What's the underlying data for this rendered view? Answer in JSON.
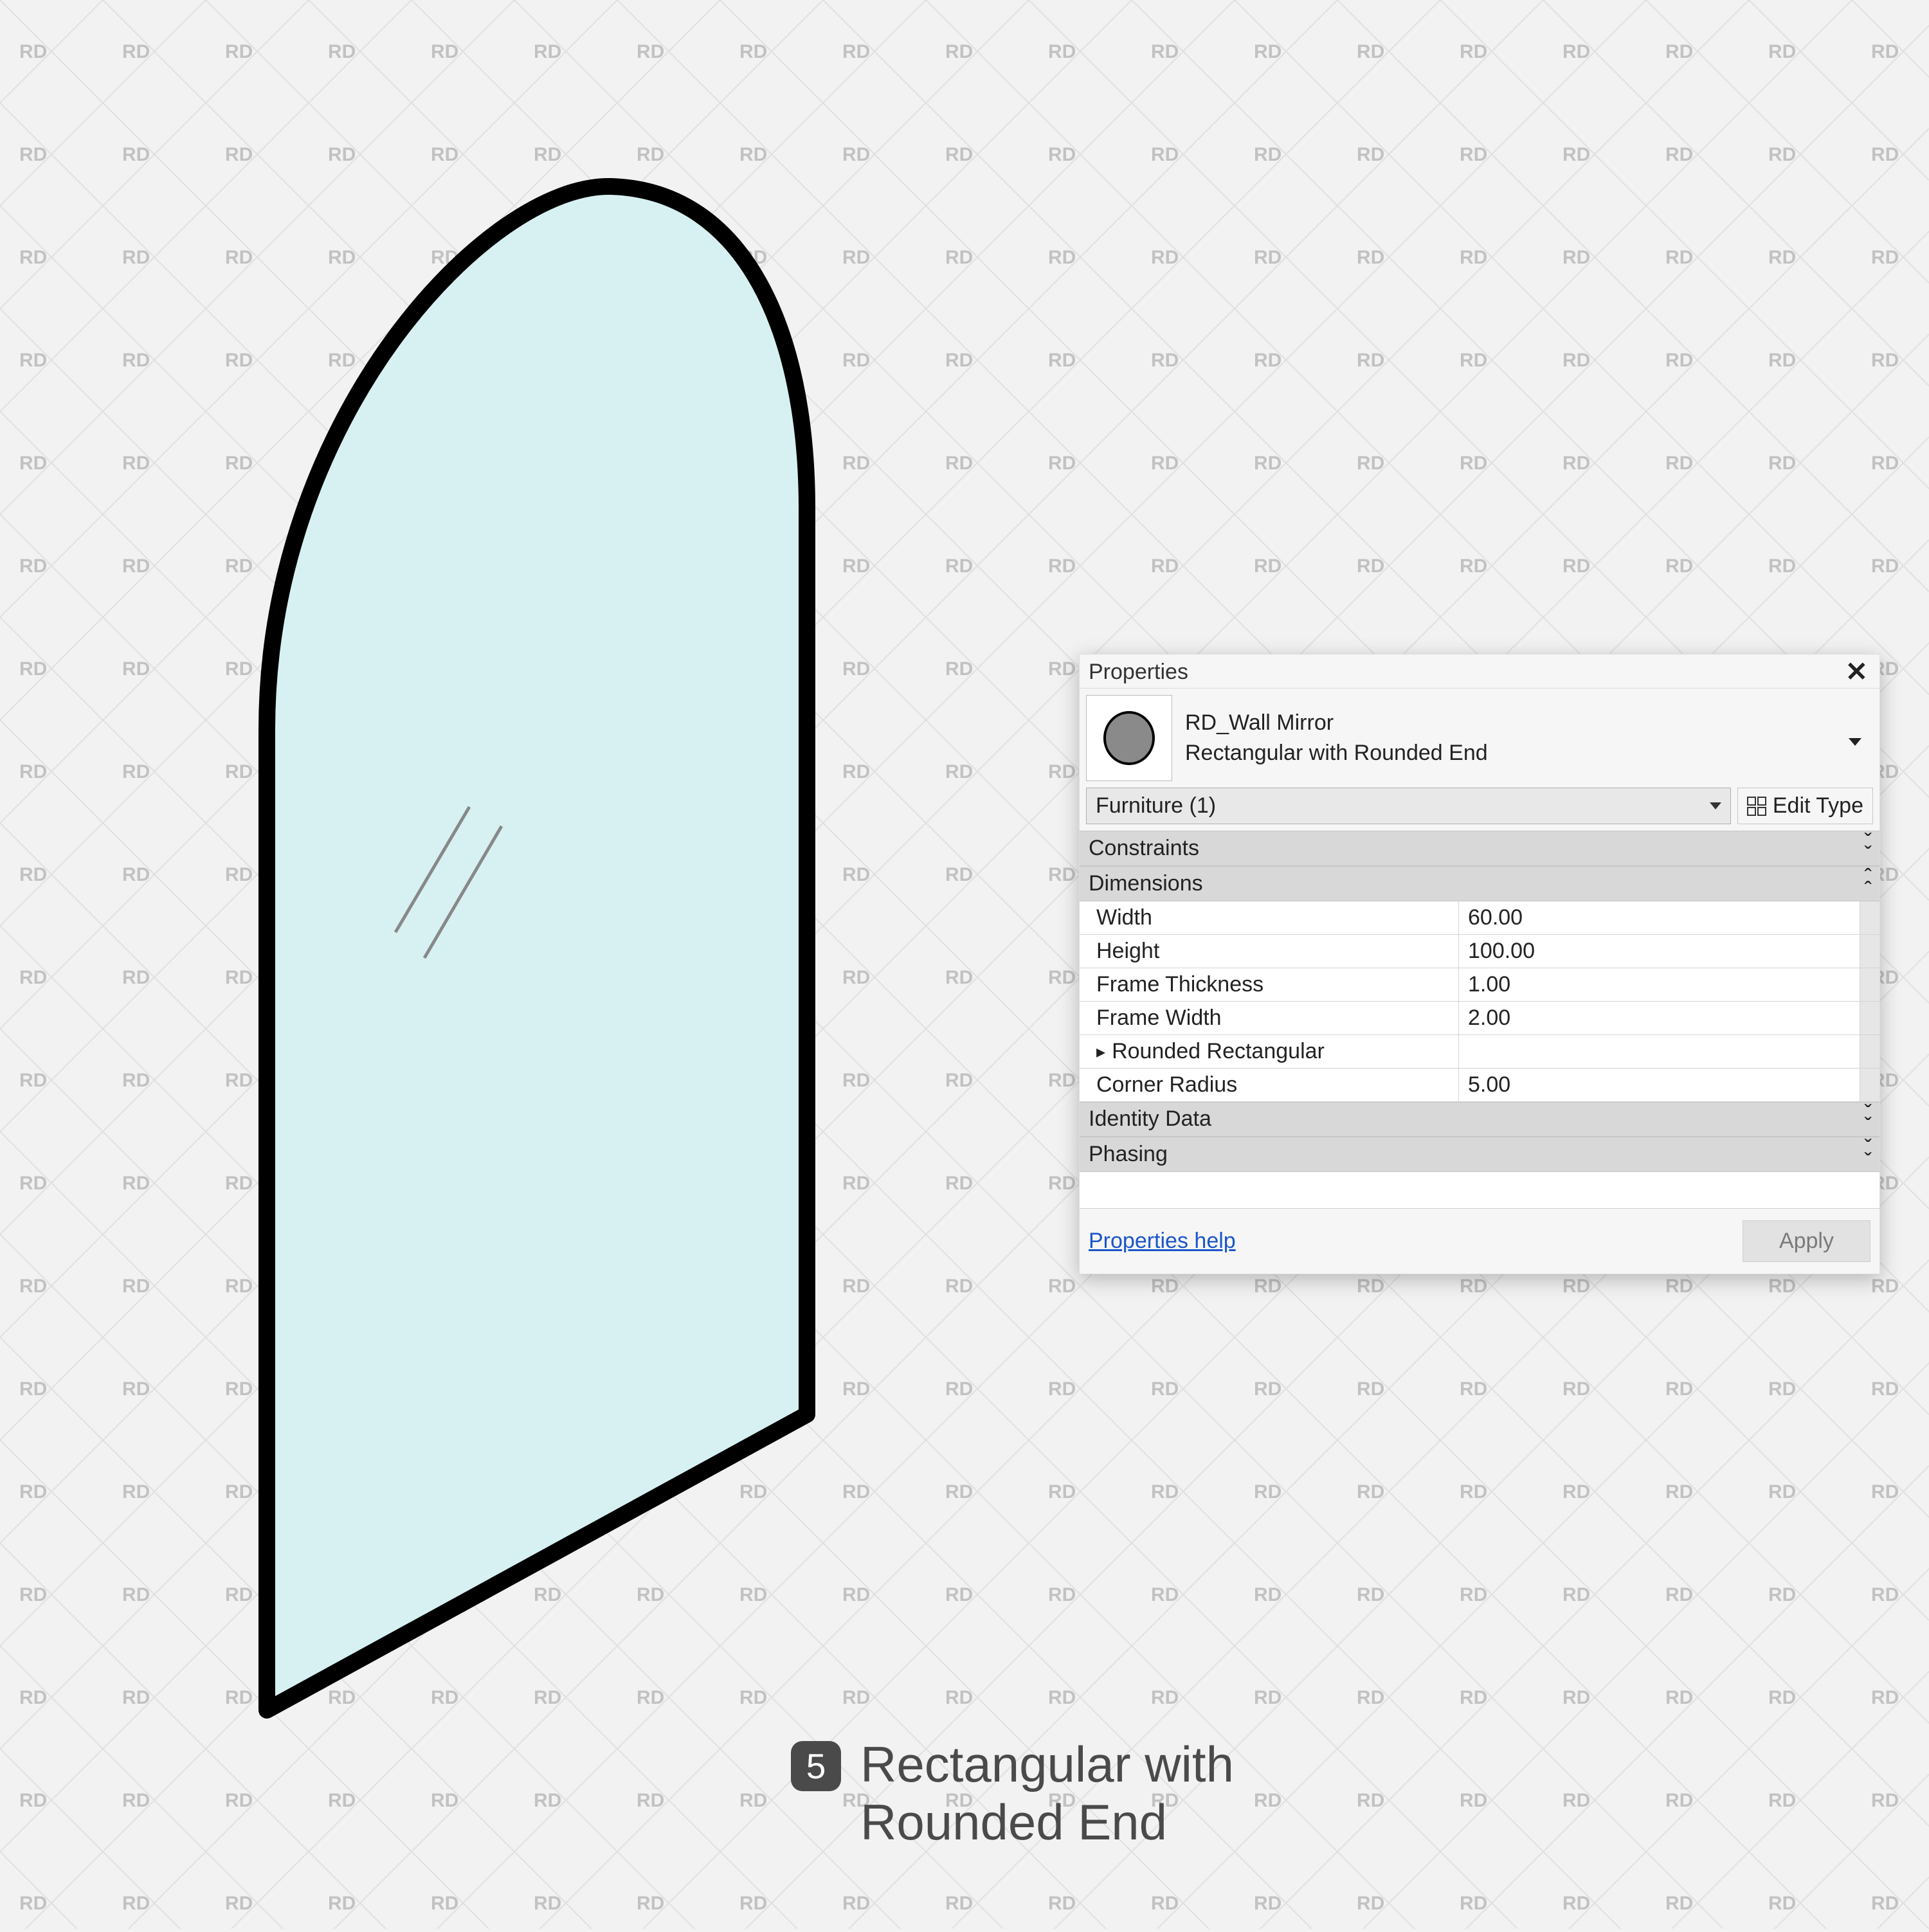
{
  "panel": {
    "title": "Properties",
    "close_title": "Close",
    "family_name": "RD_Wall Mirror",
    "type_name": "Rectangular with Rounded End",
    "category_select": "Furniture (1)",
    "edit_type_label": "Edit Type",
    "groups": {
      "constraints": "Constraints",
      "dimensions": "Dimensions",
      "identity": "Identity Data",
      "phasing": "Phasing"
    },
    "params": {
      "width": {
        "label": "Width",
        "value": "60.00"
      },
      "height": {
        "label": "Height",
        "value": "100.00"
      },
      "frame_thickness": {
        "label": "Frame Thickness",
        "value": "1.00"
      },
      "frame_width": {
        "label": "Frame Width",
        "value": "2.00"
      },
      "rounded_rectangular": {
        "label": "Rounded Rectangular",
        "value": ""
      },
      "corner_radius": {
        "label": "Corner Radius",
        "value": "5.00"
      }
    },
    "help_link": "Properties help",
    "apply_label": "Apply"
  },
  "caption": {
    "number": "5",
    "line1": "Rectangular with",
    "line2": "Rounded End"
  },
  "watermark_text": "RD"
}
